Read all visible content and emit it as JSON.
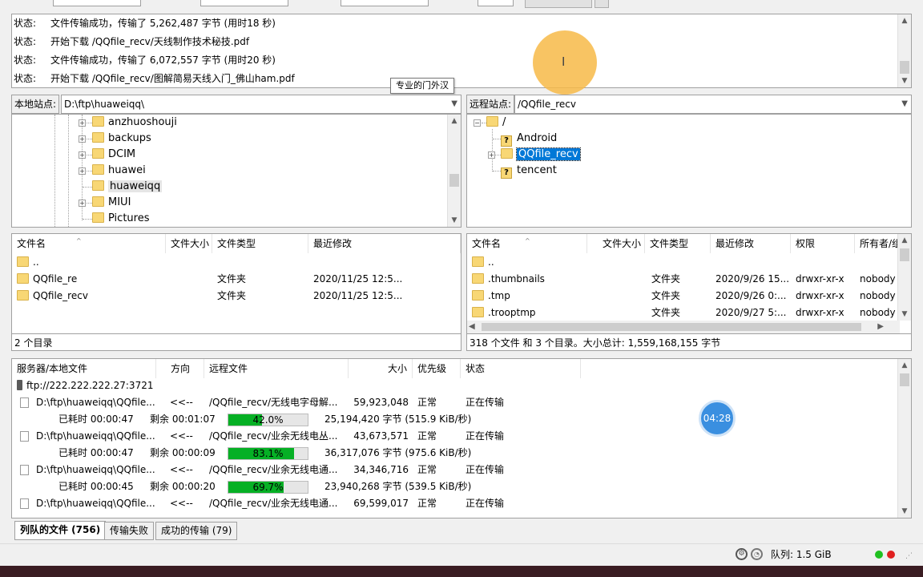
{
  "log": {
    "rows": [
      {
        "label": "状态:",
        "text": "文件传输成功，传输了 5,262,487 字节 (用时18 秒)"
      },
      {
        "label": "状态:",
        "text": "开始下载 /QQfile_recv/天线制作技术秘技.pdf"
      },
      {
        "label": "状态:",
        "text": "文件传输成功，传输了 6,072,557 字节 (用时20 秒)"
      },
      {
        "label": "状态:",
        "text": "开始下载 /QQfile_recv/图解简易天线入门_佛山ham.pdf"
      }
    ]
  },
  "tooltip": "专业的门外汉",
  "local": {
    "site_label": "本地站点:",
    "path": "D:\\ftp\\huaweiqq\\",
    "tree": [
      "anzhuoshouji",
      "backups",
      "DCIM",
      "huawei",
      "huaweiqq",
      "MIUI",
      "Pictures"
    ],
    "columns": [
      "文件名",
      "文件大小",
      "文件类型",
      "最近修改"
    ],
    "files": [
      {
        "name": "..",
        "size": "",
        "type": "",
        "modified": ""
      },
      {
        "name": "QQfile_re",
        "size": "",
        "type": "文件夹",
        "modified": "2020/11/25 12:5..."
      },
      {
        "name": "QQfile_recv",
        "size": "",
        "type": "文件夹",
        "modified": "2020/11/25 12:5..."
      }
    ],
    "status": "2 个目录"
  },
  "remote": {
    "site_label": "远程站点:",
    "path": "/QQfile_recv",
    "tree": {
      "root": "/",
      "children": [
        "Android",
        "QQfile_recv",
        "tencent"
      ]
    },
    "columns": [
      "文件名",
      "文件大小",
      "文件类型",
      "最近修改",
      "权限",
      "所有者/组"
    ],
    "files": [
      {
        "name": "..",
        "size": "",
        "type": "",
        "modified": "",
        "perm": "",
        "owner": ""
      },
      {
        "name": ".thumbnails",
        "size": "",
        "type": "文件夹",
        "modified": "2020/9/26 15...",
        "perm": "drwxr-xr-x",
        "owner": "nobody"
      },
      {
        "name": ".tmp",
        "size": "",
        "type": "文件夹",
        "modified": "2020/9/26 0:...",
        "perm": "drwxr-xr-x",
        "owner": "nobody"
      },
      {
        "name": ".trooptmp",
        "size": "",
        "type": "文件夹",
        "modified": "2020/9/27 5:...",
        "perm": "drwxr-xr-x",
        "owner": "nobody"
      }
    ],
    "status": "318 个文件 和 3 个目录。大小总计: 1,559,168,155 字节"
  },
  "queue": {
    "columns": [
      "服务器/本地文件",
      "方向",
      "远程文件",
      "大小",
      "优先级",
      "状态"
    ],
    "server": "ftp://222.222.222.27:3721",
    "items": [
      {
        "local": "D:\\ftp\\huaweiqq\\QQfile...",
        "dir": "<<--",
        "remote": "/QQfile_recv/无线电字母解...",
        "size": "59,923,048",
        "priority": "正常",
        "status": "正在传输",
        "elapsed": "已耗时 00:00:47",
        "remaining": "剩余 00:01:07",
        "progress_text": "42.0%",
        "progress": 0.42,
        "bytes": "25,194,420 字节 (515.9 KiB/秒)"
      },
      {
        "local": "D:\\ftp\\huaweiqq\\QQfile...",
        "dir": "<<--",
        "remote": "/QQfile_recv/业余无线电丛...",
        "size": "43,673,571",
        "priority": "正常",
        "status": "正在传输",
        "elapsed": "已耗时 00:00:47",
        "remaining": "剩余 00:00:09",
        "progress_text": "83.1%",
        "progress": 0.831,
        "bytes": "36,317,076 字节 (975.6 KiB/秒)"
      },
      {
        "local": "D:\\ftp\\huaweiqq\\QQfile...",
        "dir": "<<--",
        "remote": "/QQfile_recv/业余无线电通...",
        "size": "34,346,716",
        "priority": "正常",
        "status": "正在传输",
        "elapsed": "已耗时 00:00:45",
        "remaining": "剩余 00:00:20",
        "progress_text": "69.7%",
        "progress": 0.697,
        "bytes": "23,940,268 字节 (539.5 KiB/秒)"
      },
      {
        "local": "D:\\ftp\\huaweiqq\\QQfile...",
        "dir": "<<--",
        "remote": "/QQfile_recv/业余无线电通...",
        "size": "69,599,017",
        "priority": "正常",
        "status": "正在传输"
      }
    ]
  },
  "timer": "04:28",
  "tabs": [
    {
      "label": "列队的文件 (756)",
      "active": true
    },
    {
      "label": "传输失败",
      "active": false
    },
    {
      "label": "成功的传输 (79)",
      "active": false
    }
  ],
  "statusbar": {
    "queue": "队列: 1.5 GiB"
  },
  "colors": {
    "progress_fill": "#06b025",
    "selection": "#0078d7",
    "folder": "#f8d775",
    "cursor_halo": "#f7ba48"
  }
}
